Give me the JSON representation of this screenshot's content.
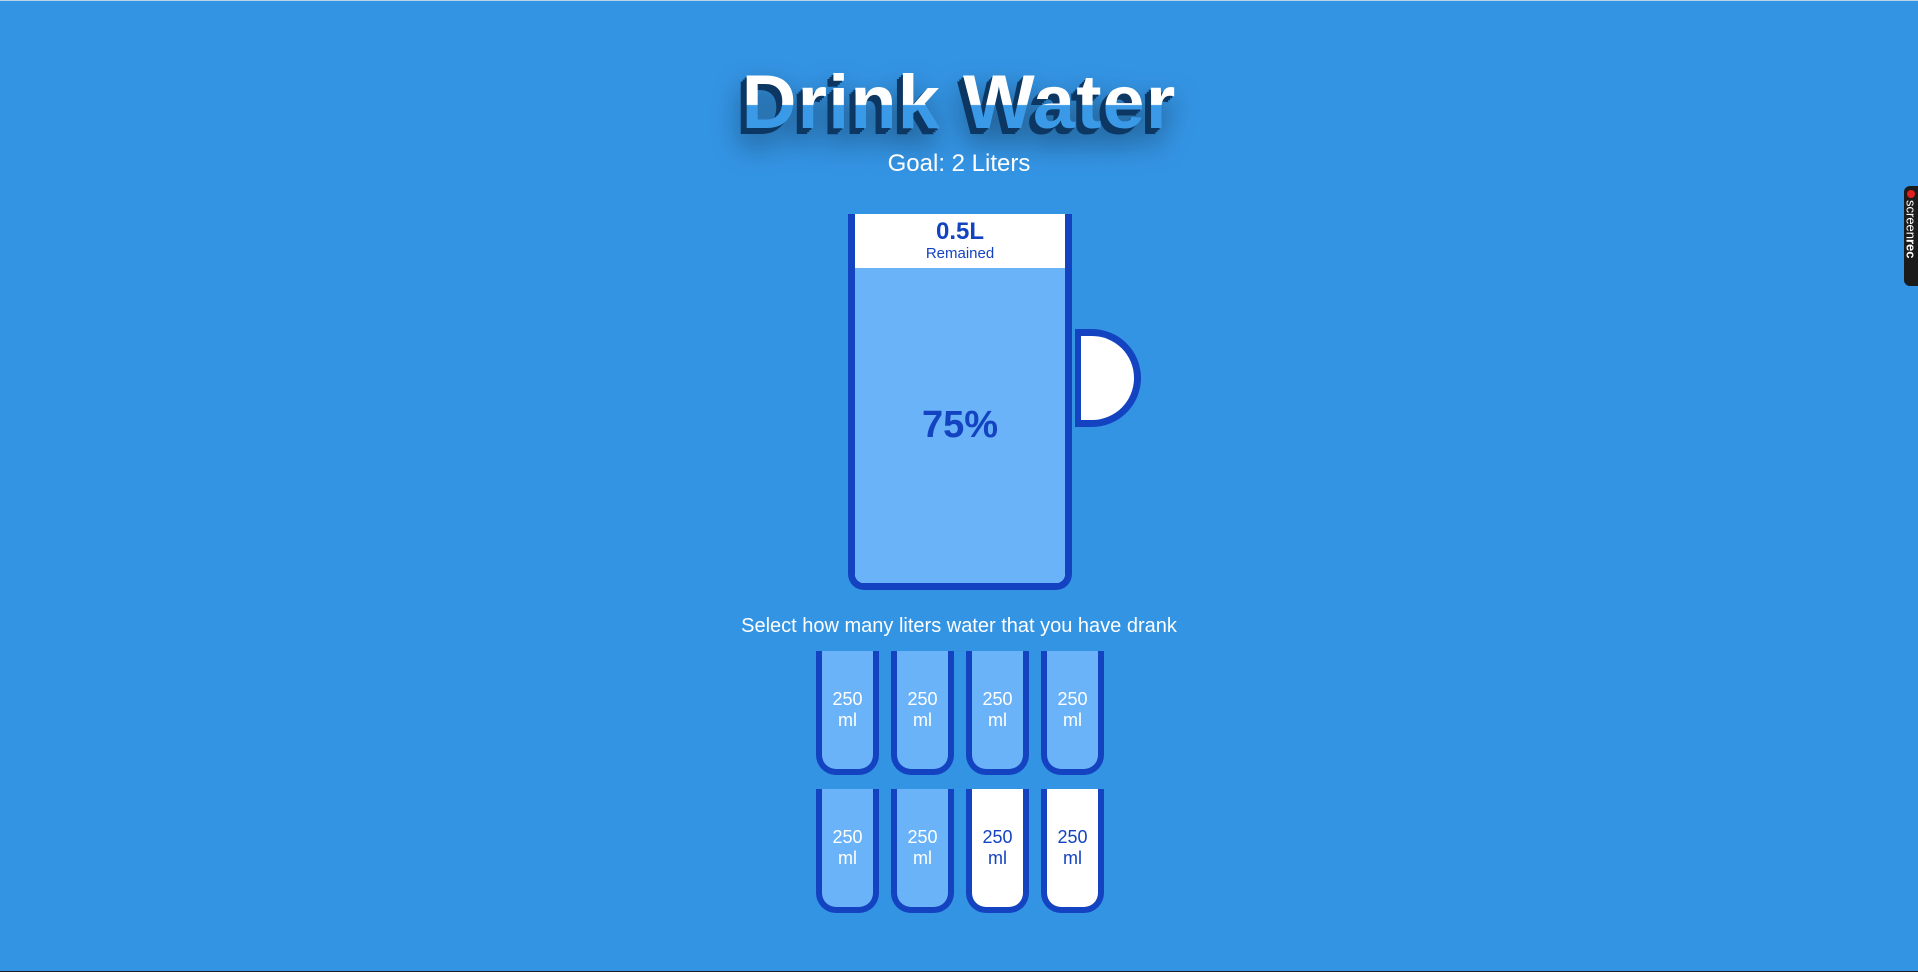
{
  "header": {
    "title": "Drink Water",
    "goal": "Goal: 2 Liters"
  },
  "big_cup": {
    "remained_amount": "0.5L",
    "remained_label": "Remained",
    "percentage_label": "75%",
    "fill_fraction": 0.75
  },
  "instruction": "Select how many liters water that you have drank",
  "small_cups": [
    {
      "amount": "250",
      "unit": "ml",
      "filled": true
    },
    {
      "amount": "250",
      "unit": "ml",
      "filled": true
    },
    {
      "amount": "250",
      "unit": "ml",
      "filled": true
    },
    {
      "amount": "250",
      "unit": "ml",
      "filled": true
    },
    {
      "amount": "250",
      "unit": "ml",
      "filled": true
    },
    {
      "amount": "250",
      "unit": "ml",
      "filled": true
    },
    {
      "amount": "250",
      "unit": "ml",
      "filled": false
    },
    {
      "amount": "250",
      "unit": "ml",
      "filled": false
    }
  ],
  "recorder_badge": {
    "text_light": "screen",
    "text_bold": "rec"
  },
  "colors": {
    "background": "#3494e4",
    "cup_border": "#1443c2",
    "water": "#6ab3f8",
    "empty": "#ffffff"
  }
}
